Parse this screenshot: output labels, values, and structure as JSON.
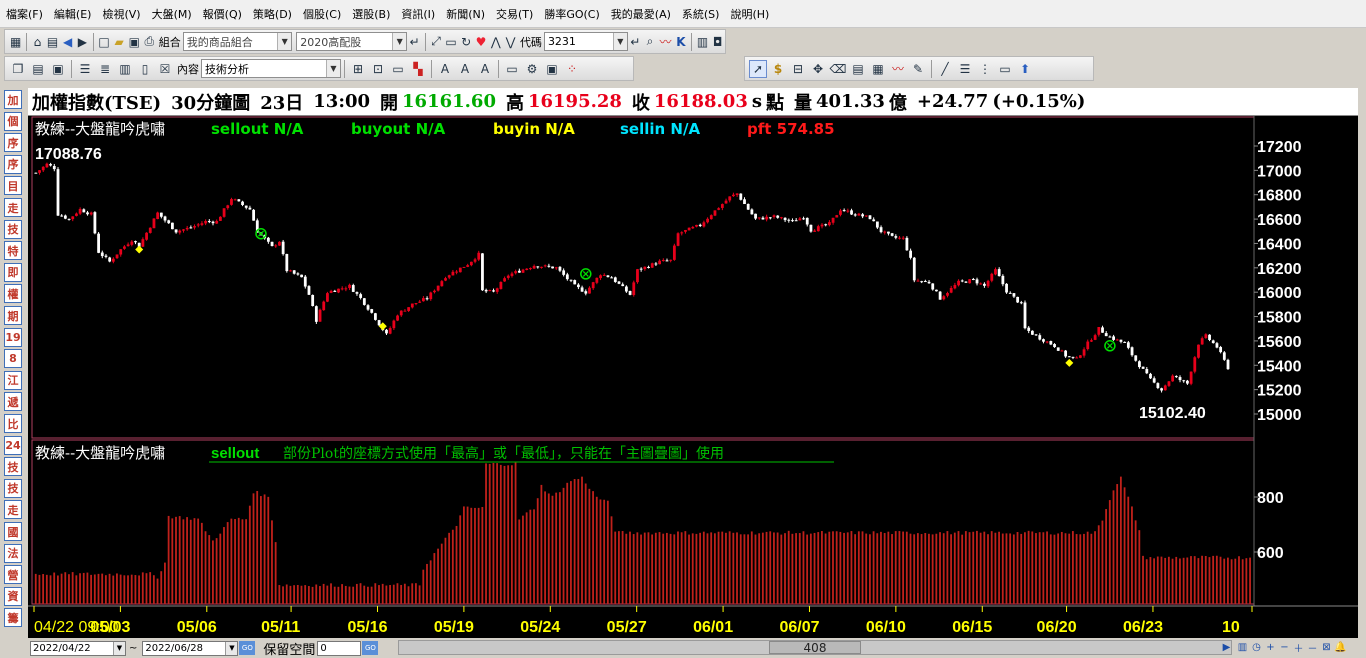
{
  "menu": [
    "檔案(F)",
    "編輯(E)",
    "檢視(V)",
    "大盤(M)",
    "報價(Q)",
    "策略(D)",
    "個股(C)",
    "選股(B)",
    "資訊(I)",
    "新聞(N)",
    "交易(T)",
    "勝率GO(C)",
    "我的最愛(A)",
    "系統(S)",
    "說明(H)"
  ],
  "toolbar1": {
    "combo_group_label": "組合",
    "combo_group_value": "我的商品組合",
    "combo_portfolio_value": "2020高配股",
    "code_label": "代碼",
    "code_value": "3231"
  },
  "toolbar2": {
    "content_label": "內容",
    "content_value": "技術分析"
  },
  "left_tabs": [
    "加",
    "個",
    "序",
    "序",
    "目",
    "走",
    "技",
    "特",
    "即",
    "權",
    "期",
    "19",
    "8",
    "江",
    "遞",
    "比",
    "24",
    "技",
    "技",
    "走",
    "國",
    "法",
    "營",
    "資",
    "籌"
  ],
  "info": {
    "symbol": "加權指數(TSE)",
    "interval": "30分鐘圖",
    "day": "23日",
    "time": "13:00",
    "open_label": "開",
    "open": "16161.60",
    "high_label": "高",
    "high": "16195.28",
    "close_label": "收",
    "close": "16188.03",
    "unit_s": "s",
    "points_label": "點",
    "volume_label": "量",
    "volume": "401.33",
    "volume_unit": "億",
    "change": "+24.77",
    "change_pct": "(+0.15%)"
  },
  "colors": {
    "up": "#e8001b",
    "down": "#ffffff",
    "volume_bar": "#c0211b",
    "signal_sellout": "#00e000",
    "signal_buyout": "#00e000",
    "signal_buyin": "#ffff00",
    "signal_sellin": "#00e5ff",
    "signal_pft": "#ff1a1a",
    "axis_text": "#ffffff",
    "date_text": "#ffff00"
  },
  "upper_pane": {
    "strategy": "教練--大盤龍吟虎嘯",
    "signals": [
      {
        "name": "sellout",
        "value": "N/A"
      },
      {
        "name": "buyout",
        "value": "N/A"
      },
      {
        "name": "buyin",
        "value": "N/A"
      },
      {
        "name": "sellin",
        "value": "N/A"
      },
      {
        "name": "pft",
        "value": "574.85"
      }
    ],
    "max_label": "17088.76",
    "min_label": "15102.40"
  },
  "lower_pane": {
    "strategy": "教練--大盤龍吟虎嘯",
    "signal_name": "sellout",
    "message": "部份Plot的座標方式使用「最高」或「最低」，只能在「主圖疊圖」使用"
  },
  "chart_data": [
    {
      "type": "candlestick",
      "title": "加權指數(TSE) 30分鐘圖",
      "yticks": [
        15000,
        15200,
        15400,
        15600,
        15800,
        16000,
        16200,
        16400,
        16600,
        16800,
        17000,
        17200
      ],
      "ylim": [
        14900,
        17300
      ],
      "xlabels": [
        "04/22 09:00",
        "05/03",
        "05/06",
        "05/11",
        "05/16",
        "05/19",
        "05/24",
        "05/27",
        "06/01",
        "06/07",
        "06/10",
        "06/15",
        "06/20",
        "06/23",
        "10"
      ],
      "anchors": [
        [
          0,
          16980
        ],
        [
          3,
          17050
        ],
        [
          5,
          17020
        ],
        [
          6,
          16640
        ],
        [
          9,
          16600
        ],
        [
          12,
          16680
        ],
        [
          15,
          16640
        ],
        [
          17,
          16330
        ],
        [
          20,
          16250
        ],
        [
          23,
          16350
        ],
        [
          26,
          16430
        ],
        [
          28,
          16380
        ],
        [
          33,
          16650
        ],
        [
          38,
          16500
        ],
        [
          42,
          16530
        ],
        [
          46,
          16580
        ],
        [
          49,
          16580
        ],
        [
          53,
          16770
        ],
        [
          58,
          16680
        ],
        [
          60,
          16500
        ],
        [
          64,
          16370
        ],
        [
          66,
          16420
        ],
        [
          68,
          16180
        ],
        [
          72,
          16120
        ],
        [
          74,
          15980
        ],
        [
          76,
          15770
        ],
        [
          79,
          16000
        ],
        [
          85,
          16050
        ],
        [
          88,
          15950
        ],
        [
          91,
          15830
        ],
        [
          95,
          15650
        ],
        [
          98,
          15820
        ],
        [
          102,
          15900
        ],
        [
          106,
          15950
        ],
        [
          111,
          16130
        ],
        [
          117,
          16230
        ],
        [
          120,
          16310
        ],
        [
          121,
          16010
        ],
        [
          124,
          16000
        ],
        [
          128,
          16140
        ],
        [
          135,
          16220
        ],
        [
          141,
          16200
        ],
        [
          146,
          16050
        ],
        [
          149,
          16000
        ],
        [
          153,
          16150
        ],
        [
          156,
          16120
        ],
        [
          161,
          15980
        ],
        [
          163,
          16180
        ],
        [
          169,
          16250
        ],
        [
          172,
          16260
        ],
        [
          174,
          16480
        ],
        [
          180,
          16550
        ],
        [
          183,
          16640
        ],
        [
          188,
          16780
        ],
        [
          190,
          16810
        ],
        [
          193,
          16680
        ],
        [
          195,
          16600
        ],
        [
          200,
          16620
        ],
        [
          205,
          16580
        ],
        [
          208,
          16620
        ],
        [
          210,
          16510
        ],
        [
          215,
          16560
        ],
        [
          218,
          16680
        ],
        [
          222,
          16640
        ],
        [
          226,
          16610
        ],
        [
          229,
          16500
        ],
        [
          232,
          16450
        ],
        [
          235,
          16440
        ],
        [
          237,
          16270
        ],
        [
          238,
          16100
        ],
        [
          242,
          16080
        ],
        [
          245,
          15950
        ],
        [
          250,
          16080
        ],
        [
          254,
          16100
        ],
        [
          257,
          16050
        ],
        [
          260,
          16180
        ],
        [
          263,
          16010
        ],
        [
          267,
          15900
        ],
        [
          268,
          15700
        ],
        [
          271,
          15640
        ],
        [
          276,
          15560
        ],
        [
          279,
          15480
        ],
        [
          282,
          15450
        ],
        [
          284,
          15540
        ],
        [
          288,
          15700
        ],
        [
          291,
          15630
        ],
        [
          295,
          15580
        ],
        [
          298,
          15440
        ],
        [
          302,
          15280
        ],
        [
          305,
          15200
        ],
        [
          308,
          15310
        ],
        [
          312,
          15250
        ],
        [
          315,
          15580
        ],
        [
          317,
          15640
        ],
        [
          320,
          15550
        ],
        [
          323,
          15380
        ]
      ],
      "markers": [
        {
          "i": 28,
          "type": "buy-diamond",
          "price": 16350
        },
        {
          "i": 61,
          "type": "exit-circle",
          "price": 16480
        },
        {
          "i": 94,
          "type": "buy-diamond",
          "price": 15720
        },
        {
          "i": 149,
          "type": "exit-circle",
          "price": 16150
        },
        {
          "i": 280,
          "type": "buy-diamond",
          "price": 15420
        },
        {
          "i": 291,
          "type": "exit-circle",
          "price": 15560
        }
      ]
    },
    {
      "type": "bar",
      "title": "教練--大盤龍吟虎嘯 sellout",
      "yticks": [
        600,
        800
      ],
      "ylim": [
        400,
        960
      ],
      "anchors": [
        [
          0,
          520
        ],
        [
          31,
          520
        ],
        [
          33,
          510
        ],
        [
          35,
          560
        ],
        [
          36,
          730
        ],
        [
          44,
          720
        ],
        [
          48,
          640
        ],
        [
          53,
          720
        ],
        [
          57,
          720
        ],
        [
          59,
          820
        ],
        [
          63,
          800
        ],
        [
          65,
          640
        ],
        [
          66,
          480
        ],
        [
          104,
          480
        ],
        [
          105,
          540
        ],
        [
          114,
          700
        ],
        [
          116,
          760
        ],
        [
          121,
          760
        ],
        [
          122,
          920
        ],
        [
          130,
          920
        ],
        [
          131,
          720
        ],
        [
          135,
          760
        ],
        [
          137,
          840
        ],
        [
          140,
          800
        ],
        [
          145,
          860
        ],
        [
          148,
          870
        ],
        [
          152,
          800
        ],
        [
          155,
          780
        ],
        [
          157,
          680
        ],
        [
          158,
          670
        ],
        [
          287,
          670
        ],
        [
          289,
          720
        ],
        [
          292,
          830
        ],
        [
          294,
          870
        ],
        [
          297,
          760
        ],
        [
          299,
          680
        ],
        [
          300,
          580
        ],
        [
          329,
          580
        ]
      ]
    }
  ]
}
